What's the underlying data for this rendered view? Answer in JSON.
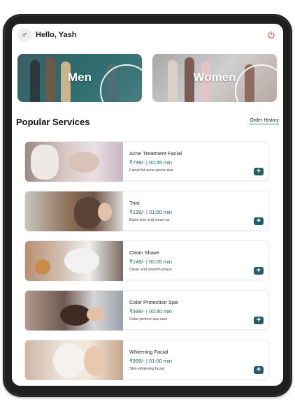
{
  "header": {
    "greeting": "Hello, Yash",
    "gender_icon": "♂"
  },
  "categories": [
    {
      "label": "Men"
    },
    {
      "label": "Women"
    }
  ],
  "section": {
    "title": "Popular Services",
    "order_history": "Order History"
  },
  "services": [
    {
      "name": "Acne Treatment Facial",
      "price": "₹799/- | 00:45 min",
      "desc": "Facial for acne-prone skin"
    },
    {
      "name": "Trim",
      "price": "₹199/- | 01:00 min",
      "desc": "Basic trim and clean-up"
    },
    {
      "name": "Clean Shave",
      "price": "₹149/- | 00:20 min",
      "desc": "Clean and smooth shave"
    },
    {
      "name": "Color Protection Spa",
      "price": "₹999/- | 00:30 min",
      "desc": "Color-protect spa care"
    },
    {
      "name": "Whitening Facial",
      "price": "₹999/- | 01:00 min",
      "desc": "Skin whitening facial"
    }
  ],
  "add_symbol": "+",
  "colors": {
    "accent": "#245e64",
    "price": "#1b5f62",
    "power": "#e05a5a"
  }
}
